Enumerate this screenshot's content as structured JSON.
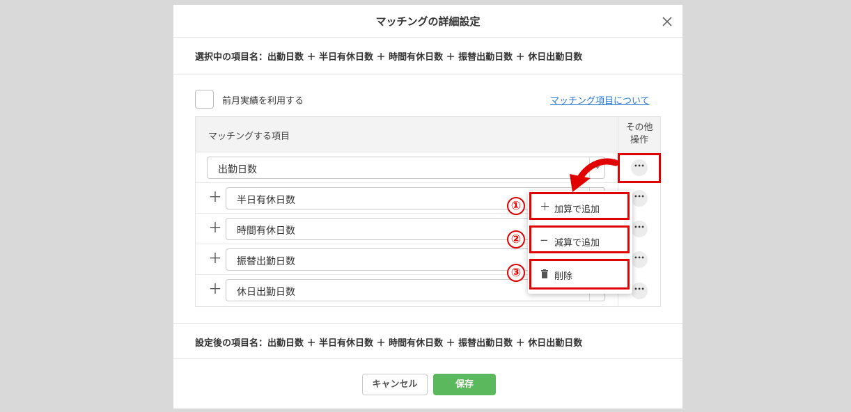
{
  "modal": {
    "title": "マッチングの詳細設定",
    "selected_items": "選択中の項目名：出勤日数 ＋ 半日有休日数 ＋ 時間有休日数 ＋ 振替出勤日数 ＋ 休日出勤日数",
    "checkbox_label": "前月実績を利用する",
    "help_link": "マッチング項目について",
    "after_items": "設定後の項目名：出勤日数 ＋ 半日有休日数 ＋ 時間有休日数 ＋ 振替出勤日数 ＋ 休日出勤日数",
    "cancel_label": "キャンセル",
    "save_label": "保存"
  },
  "table": {
    "header_item": "マッチングする項目",
    "header_ops_line1": "その他",
    "header_ops_line2": "操作",
    "rows": [
      {
        "operator": "",
        "value": "出勤日数"
      },
      {
        "operator": "＋",
        "value": "半日有休日数"
      },
      {
        "operator": "＋",
        "value": "時間有休日数"
      },
      {
        "operator": "＋",
        "value": "振替出勤日数"
      },
      {
        "operator": "＋",
        "value": "休日出勤日数"
      }
    ]
  },
  "menu": {
    "items": [
      {
        "icon": "plus-icon",
        "glyph": "＋",
        "label": "加算で追加"
      },
      {
        "icon": "minus-icon",
        "glyph": "−",
        "label": "減算で追加"
      },
      {
        "icon": "trash-icon",
        "glyph": "",
        "label": "削除"
      }
    ]
  },
  "annotations": {
    "badges": [
      "①",
      "②",
      "③"
    ],
    "highlight_color": "#e00000"
  },
  "colors": {
    "save": "#5cb85c",
    "link": "#2a7bd6"
  }
}
